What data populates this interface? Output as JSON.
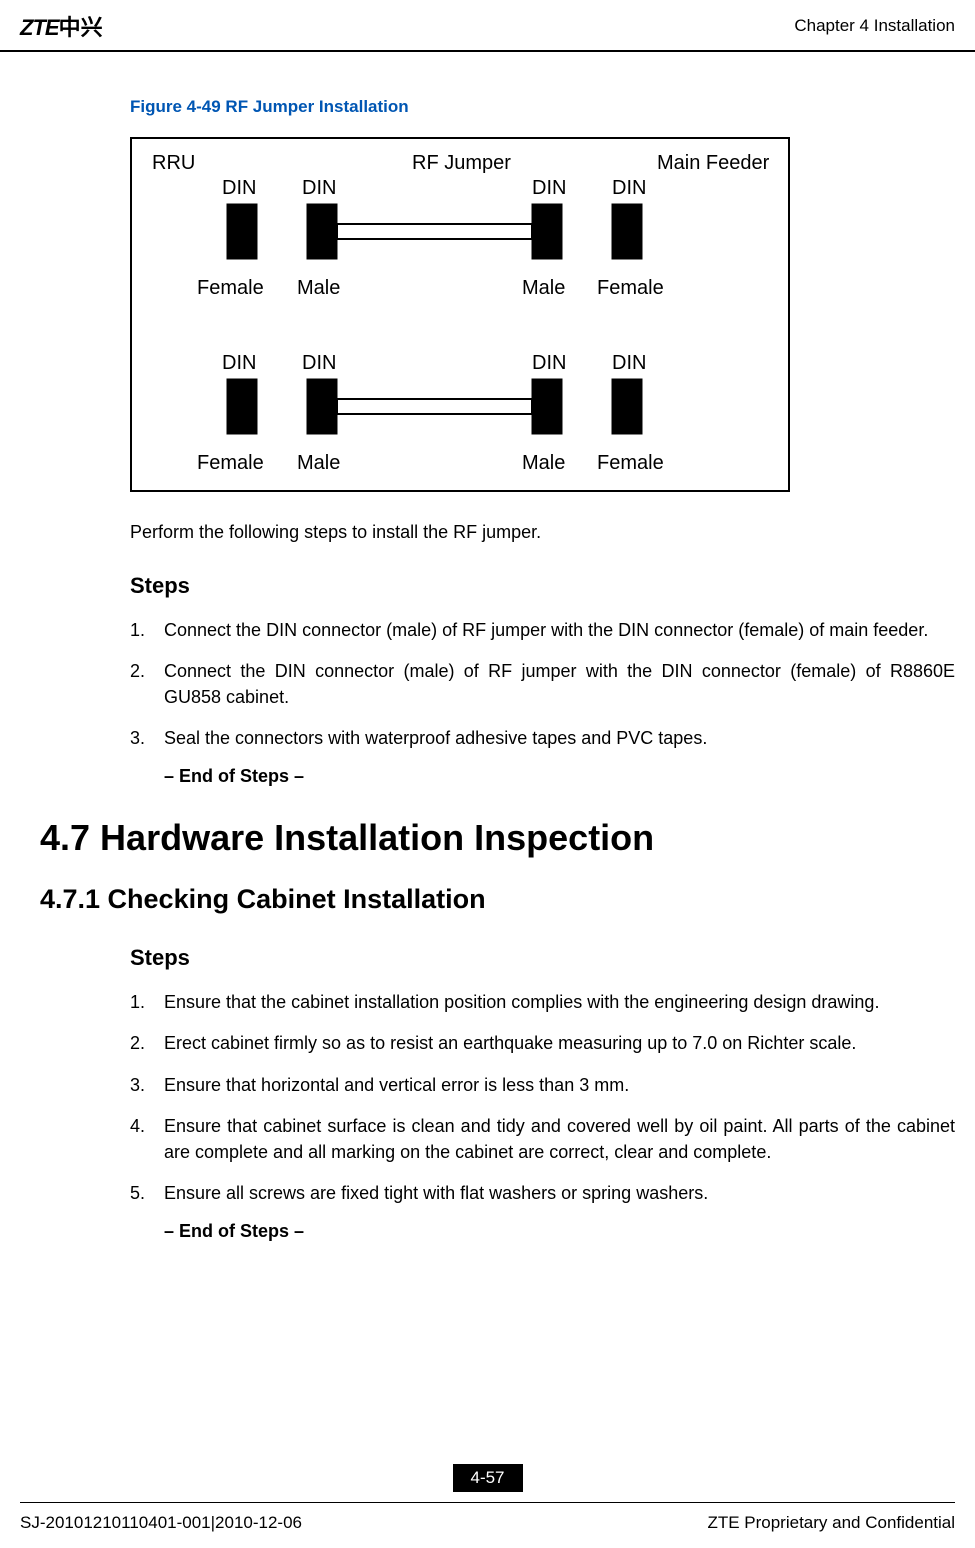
{
  "header": {
    "logo_main": "ZTE",
    "logo_chinese": "中兴",
    "chapter": "Chapter 4 Installation"
  },
  "figure": {
    "title": "Figure 4-49 RF Jumper Installation",
    "labels": {
      "rru": "RRU",
      "rf_jumper": "RF Jumper",
      "main_feeder": "Main Feeder",
      "din": "DIN",
      "female": "Female",
      "male": "Male"
    }
  },
  "intro": "Perform the following steps to install the RF jumper.",
  "steps_heading": "Steps",
  "steps_section_1": {
    "items": [
      "Connect the DIN connector (male) of RF jumper with the DIN connector (female) of main feeder.",
      "Connect the DIN connector (male) of RF jumper with the DIN connector (female) of R8860E GU858 cabinet.",
      "Seal the connectors with waterproof adhesive tapes and PVC tapes."
    ],
    "end": "– End of Steps –"
  },
  "section_4_7": "4.7 Hardware Installation Inspection",
  "section_4_7_1": "4.7.1 Checking Cabinet Installation",
  "steps_section_2": {
    "items": [
      "Ensure that the cabinet installation position complies with the engineering design drawing.",
      "Erect cabinet firmly so as to resist an earthquake measuring up to 7.0 on Richter scale.",
      "Ensure that horizontal and vertical error is less than 3 mm.",
      "Ensure that cabinet surface is clean and tidy and covered well by oil paint. All parts of the cabinet are complete and all marking on the cabinet are correct, clear and complete.",
      "Ensure all screws are fixed tight with flat washers or spring washers."
    ],
    "end": "– End of Steps –"
  },
  "footer": {
    "page_number": "4-57",
    "doc_id": "SJ-20101210110401-001|2010-12-06",
    "confidential": "ZTE Proprietary and Confidential"
  }
}
